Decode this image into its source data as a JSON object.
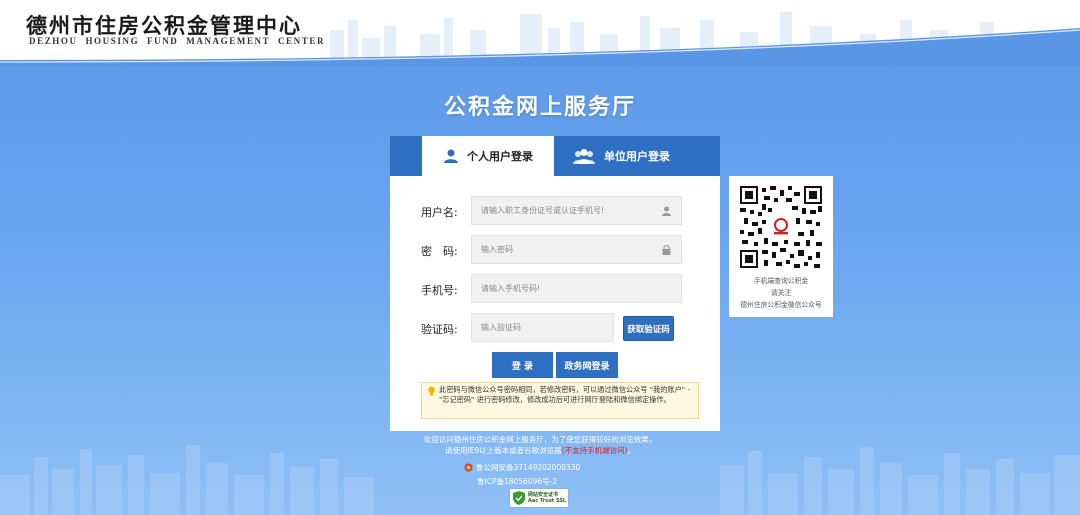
{
  "header": {
    "logo_cn": "德州市住房公积金管理中心",
    "logo_en": "DEZHOU HOUSING FUND MANAGEMENT CENTER"
  },
  "page_title": "公积金网上服务厅",
  "tabs": [
    {
      "label": "个人用户登录",
      "icon": "person-icon",
      "active": true
    },
    {
      "label": "单位用户登录",
      "icon": "group-icon",
      "active": false
    }
  ],
  "form": {
    "username": {
      "label": "用户名:",
      "placeholder": "请输入职工身份证号或认证手机号!",
      "icon": "user-icon"
    },
    "password": {
      "label": "密　码:",
      "placeholder": "输入密码",
      "icon": "lock-icon"
    },
    "phone": {
      "label": "手机号:",
      "placeholder": "请输入手机号码!"
    },
    "captcha": {
      "label": "验证码:",
      "placeholder": "输入验证码",
      "button": "获取验证码"
    }
  },
  "buttons": {
    "login": "登 录",
    "gov_login": "政务网登录"
  },
  "notice": "此密码与微信公众号密码相同，若修改密码，可以通过微信公众号 \"我的账户\" - \"忘记密码\" 进行密码修改，修改成功后可进行网厅登陆和微信绑定操作。",
  "qr": {
    "line1": "手机端查询公积金",
    "line2": "请关注",
    "line3": "德州住房公积金微信公众号"
  },
  "footer": {
    "welcome": "欢迎访问德州住房公积金网上服务厅，为了使您获得较好的浏览效果，",
    "browser_prefix": "请使用IE9以上版本或者谷歌浏览器",
    "browser_warning": "(不支持手机端访问)",
    "browser_suffix": "。",
    "police": "鲁公网安备37149202000330",
    "icp": "鲁ICP备18056096号-2",
    "trust_line1": "网站安全证书",
    "trust_line2": "Aac Trust SSL"
  },
  "colors": {
    "primary": "#2f6fc2",
    "background": "#6aa7f0",
    "warning": "#e02020"
  }
}
